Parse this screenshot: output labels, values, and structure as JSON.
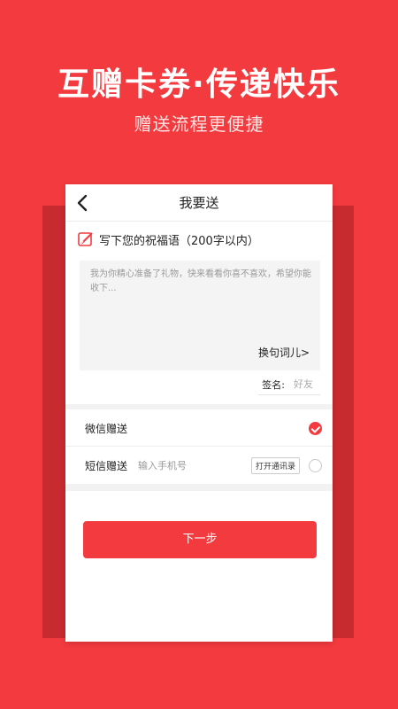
{
  "promo": {
    "headline": "互赠卡券·传递快乐",
    "subline": "赠送流程更便捷"
  },
  "nav": {
    "title": "我要送",
    "back_icon": "chevron-left-icon"
  },
  "wish": {
    "icon": "pen-icon",
    "label": "写下您的祝福语（200字以内）",
    "message": "我为你精心准备了礼物，快来看看你喜不喜欢，希望你能收下...",
    "swap_label": "换句词儿>"
  },
  "signature": {
    "label": "签名:",
    "placeholder": "好友"
  },
  "send_options": {
    "wechat": {
      "label": "微信赠送",
      "selected": true
    },
    "sms": {
      "label": "短信赠送",
      "phone_placeholder": "输入手机号",
      "contacts_label": "打开通讯录",
      "selected": false
    }
  },
  "next_label": "下一步",
  "colors": {
    "accent": "#f33a3f",
    "background": "#f33a3f"
  }
}
